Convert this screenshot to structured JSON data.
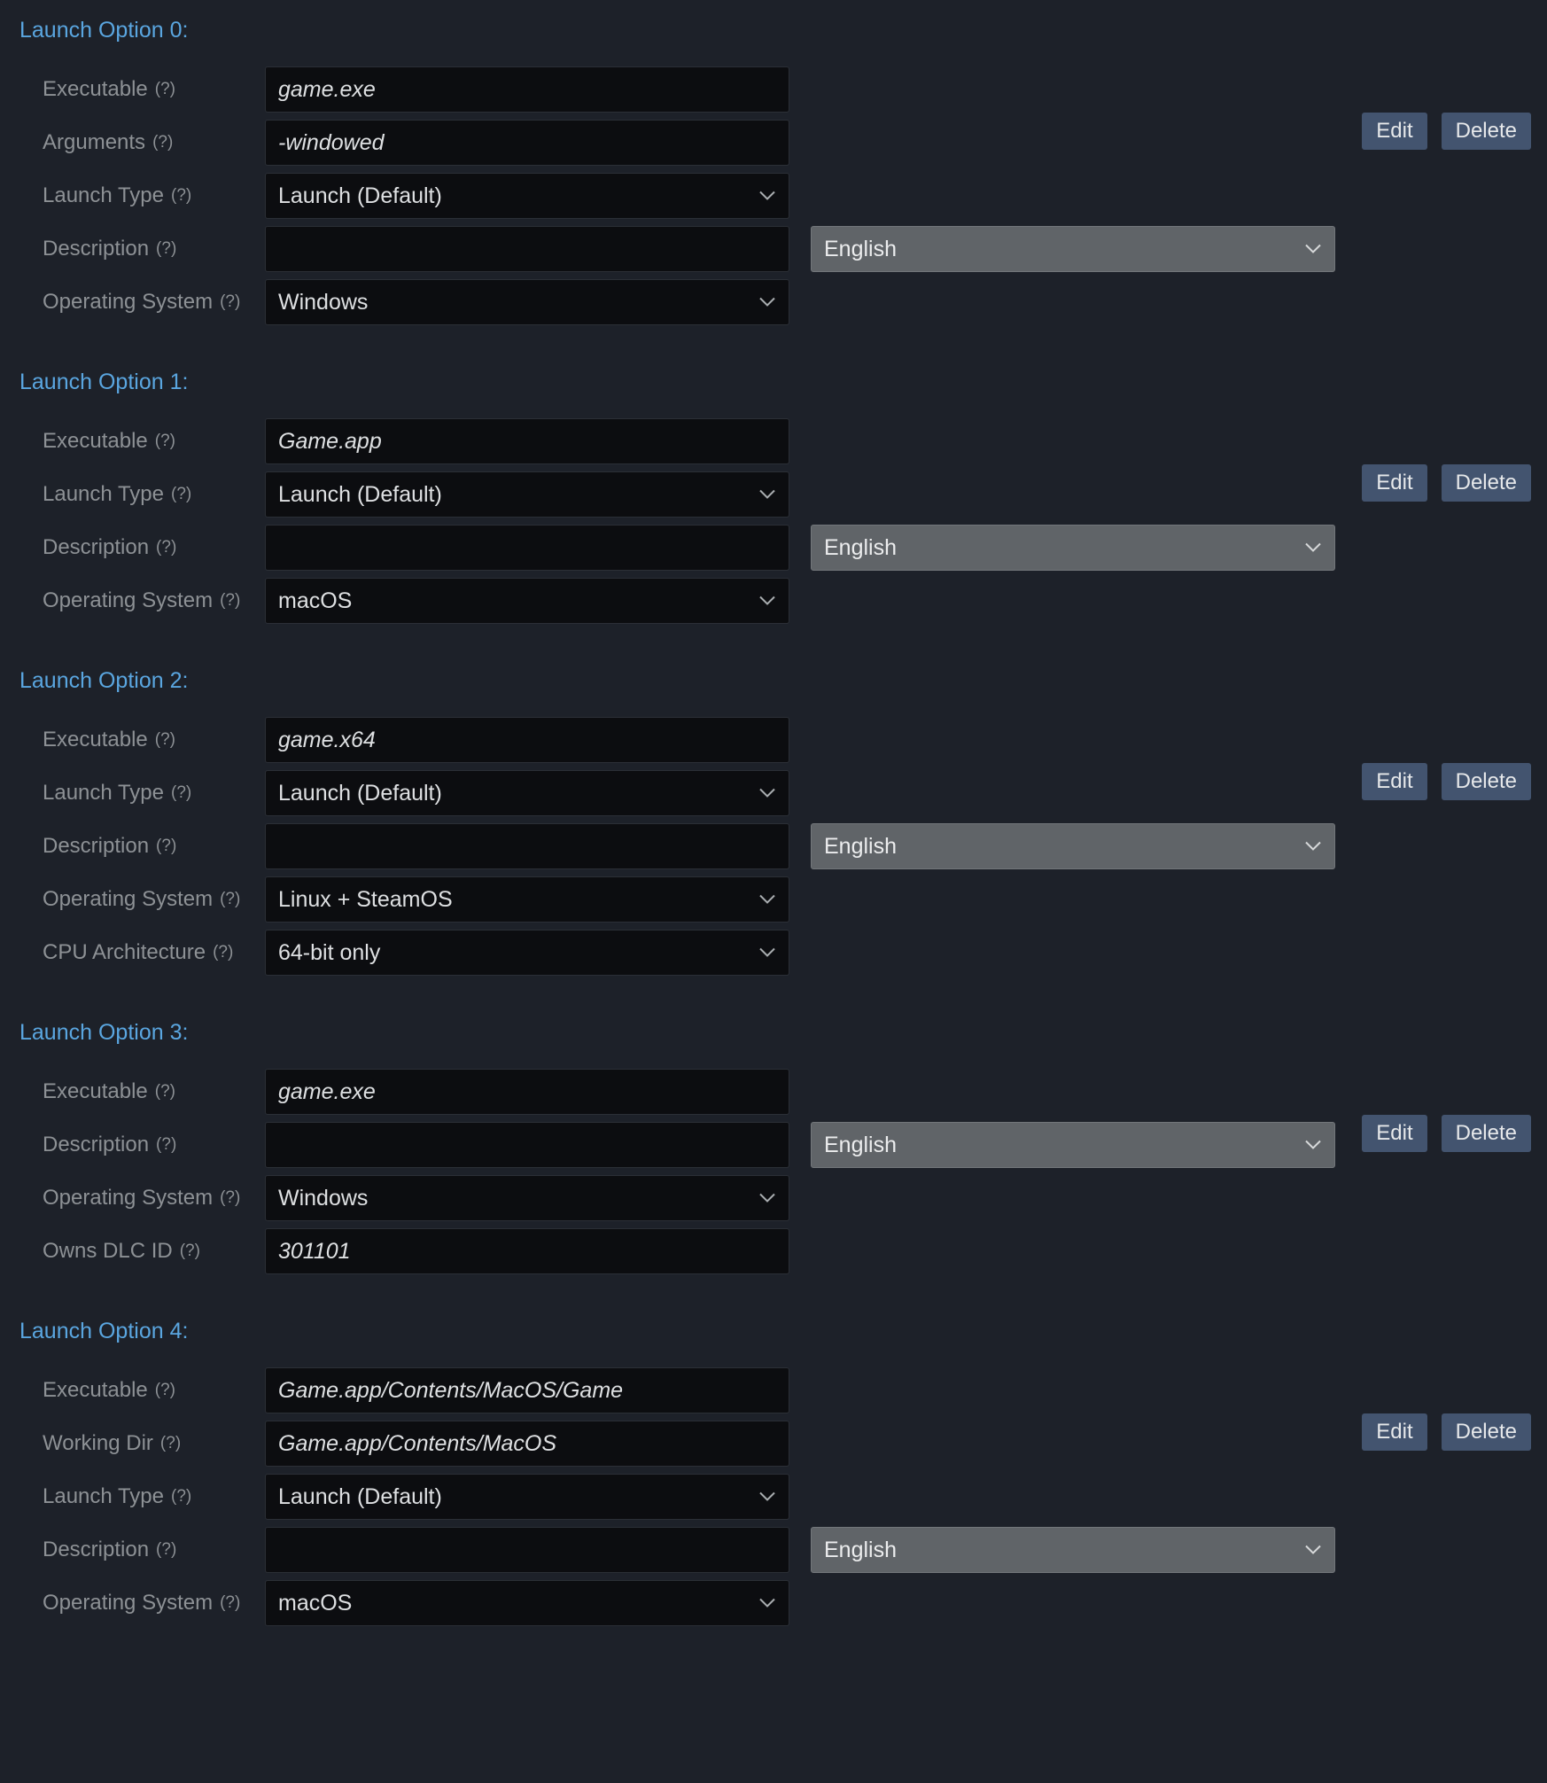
{
  "hint": "(?)",
  "buttons": {
    "edit": "Edit",
    "delete": "Delete"
  },
  "labels": {
    "executable": "Executable",
    "arguments": "Arguments",
    "launch_type": "Launch Type",
    "description": "Description",
    "os": "Operating System",
    "cpu": "CPU Architecture",
    "owns_dlc": "Owns DLC ID",
    "working_dir": "Working Dir"
  },
  "options": [
    {
      "title": "Launch Option 0:",
      "rows": [
        {
          "kind": "text",
          "label_key": "executable",
          "value": "game.exe"
        },
        {
          "kind": "text",
          "label_key": "arguments",
          "value": "-windowed"
        },
        {
          "kind": "select",
          "label_key": "launch_type",
          "value": "Launch (Default)"
        },
        {
          "kind": "desc",
          "label_key": "description",
          "value": "",
          "lang": "English"
        },
        {
          "kind": "select",
          "label_key": "os",
          "value": "Windows"
        }
      ]
    },
    {
      "title": "Launch Option 1:",
      "rows": [
        {
          "kind": "text",
          "label_key": "executable",
          "value": "Game.app"
        },
        {
          "kind": "select",
          "label_key": "launch_type",
          "value": "Launch (Default)"
        },
        {
          "kind": "desc",
          "label_key": "description",
          "value": "",
          "lang": "English"
        },
        {
          "kind": "select",
          "label_key": "os",
          "value": "macOS"
        }
      ]
    },
    {
      "title": "Launch Option 2:",
      "rows": [
        {
          "kind": "text",
          "label_key": "executable",
          "value": "game.x64"
        },
        {
          "kind": "select",
          "label_key": "launch_type",
          "value": "Launch (Default)"
        },
        {
          "kind": "desc",
          "label_key": "description",
          "value": "",
          "lang": "English"
        },
        {
          "kind": "select",
          "label_key": "os",
          "value": "Linux + SteamOS"
        },
        {
          "kind": "select",
          "label_key": "cpu",
          "value": "64-bit only"
        }
      ]
    },
    {
      "title": "Launch Option 3:",
      "rows": [
        {
          "kind": "text",
          "label_key": "executable",
          "value": "game.exe"
        },
        {
          "kind": "desc",
          "label_key": "description",
          "value": "",
          "lang": "English"
        },
        {
          "kind": "select",
          "label_key": "os",
          "value": "Windows"
        },
        {
          "kind": "text",
          "label_key": "owns_dlc",
          "value": "301101"
        }
      ]
    },
    {
      "title": "Launch Option 4:",
      "rows": [
        {
          "kind": "text",
          "label_key": "executable",
          "value": "Game.app/Contents/MacOS/Game"
        },
        {
          "kind": "text",
          "label_key": "working_dir",
          "value": "Game.app/Contents/MacOS"
        },
        {
          "kind": "select",
          "label_key": "launch_type",
          "value": "Launch (Default)"
        },
        {
          "kind": "desc",
          "label_key": "description",
          "value": "",
          "lang": "English"
        },
        {
          "kind": "select",
          "label_key": "os",
          "value": "macOS"
        }
      ]
    }
  ]
}
